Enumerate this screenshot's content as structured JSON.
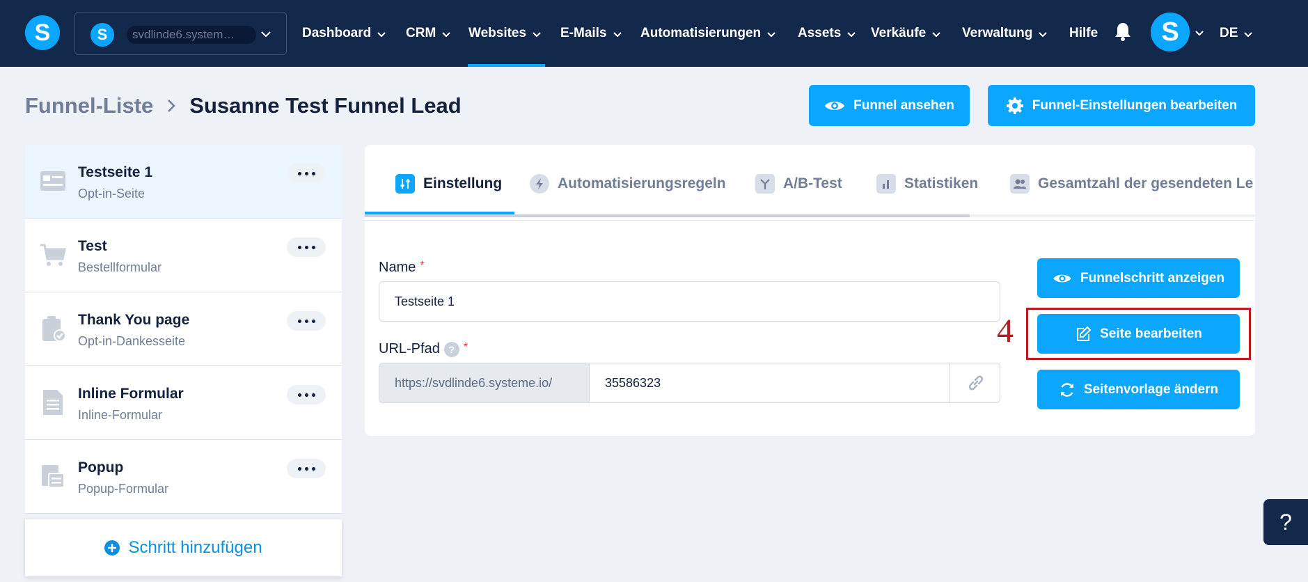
{
  "nav": {
    "logo_letter": "S",
    "account": {
      "avatar_letter": "S",
      "name": "svdlinde6.system…"
    },
    "items": [
      {
        "label": "Dashboard"
      },
      {
        "label": "CRM"
      },
      {
        "label": "Websites",
        "active": true
      },
      {
        "label": "E-Mails"
      },
      {
        "label": "Automatisierungen"
      },
      {
        "label": "Assets"
      },
      {
        "label": "Verkäufe"
      },
      {
        "label": "Verwaltung"
      }
    ],
    "help_label": "Hilfe",
    "user_avatar_letter": "S",
    "language": "DE",
    "accent_color": "#0ba6ff",
    "bar_color": "#13294b"
  },
  "header": {
    "breadcrumb_parent": "Funnel-Liste",
    "breadcrumb_current": "Susanne Test Funnel Lead",
    "view_button": "Funnel ansehen",
    "settings_button": "Funnel-Einstellungen bearbeiten"
  },
  "steps": [
    {
      "title": "Testseite 1",
      "subtitle": "Opt-in-Seite",
      "icon": "optin-page-icon",
      "active": true
    },
    {
      "title": "Test",
      "subtitle": "Bestellformular",
      "icon": "shopping-cart-icon"
    },
    {
      "title": "Thank You page",
      "subtitle": "Opt-in-Dankesseite",
      "icon": "clipboard-check-icon"
    },
    {
      "title": "Inline Formular",
      "subtitle": "Inline-Formular",
      "icon": "document-icon"
    },
    {
      "title": "Popup",
      "subtitle": "Popup-Formular",
      "icon": "popup-form-icon"
    }
  ],
  "add_step_label": "Schritt hinzufügen",
  "tabs": [
    {
      "label": "Einstellung",
      "icon": "sliders-icon",
      "active": true
    },
    {
      "label": "Automatisierungsregeln",
      "icon": "bolt-icon"
    },
    {
      "label": "A/B-Test",
      "icon": "split-icon"
    },
    {
      "label": "Statistiken",
      "icon": "bar-chart-icon"
    },
    {
      "label": "Gesamtzahl der gesendeten Le",
      "icon": "users-icon"
    }
  ],
  "form": {
    "name_label": "Name",
    "name_value": "Testseite 1",
    "url_label": "URL-Pfad",
    "url_prefix": "https://svdlinde6.systeme.io/",
    "url_slug": "35586323",
    "required_mark": "*",
    "help_mark": "?"
  },
  "actions": {
    "show_step": "Funnelschritt anzeigen",
    "edit_page": "Seite bearbeiten",
    "change_template": "Seitenvorlage ändern"
  },
  "annotation": {
    "number": "4",
    "color": "#b51f24"
  },
  "help_fab_label": "?"
}
